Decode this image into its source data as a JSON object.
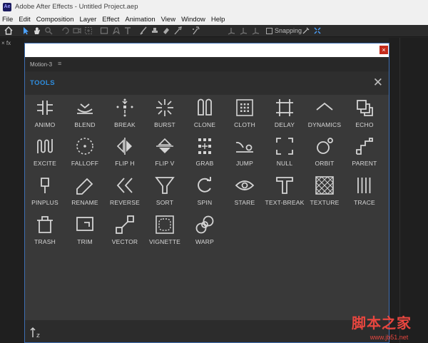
{
  "window": {
    "app_logo_text": "Ae",
    "title": "Adobe After Effects - Untitled Project.aep"
  },
  "menu": [
    "File",
    "Edit",
    "Composition",
    "Layer",
    "Effect",
    "Animation",
    "View",
    "Window",
    "Help"
  ],
  "toolbar": {
    "snapping_label": "Snapping"
  },
  "panel": {
    "tab_label": "Motion-3",
    "tab_menu_glyph": "≡",
    "section_title": "TOOLS",
    "close_glyph": "✕",
    "window_close_glyph": "×",
    "tools": [
      {
        "label": "ANIMO",
        "icon": "animo-icon"
      },
      {
        "label": "BLEND",
        "icon": "blend-icon"
      },
      {
        "label": "BREAK",
        "icon": "break-icon"
      },
      {
        "label": "BURST",
        "icon": "burst-icon"
      },
      {
        "label": "CLONE",
        "icon": "clone-icon"
      },
      {
        "label": "CLOTH",
        "icon": "cloth-icon"
      },
      {
        "label": "DELAY",
        "icon": "delay-icon"
      },
      {
        "label": "DYNAMICS",
        "icon": "dynamics-icon"
      },
      {
        "label": "ECHO",
        "icon": "echo-icon"
      },
      {
        "label": "EXCITE",
        "icon": "excite-icon"
      },
      {
        "label": "FALLOFF",
        "icon": "falloff-icon"
      },
      {
        "label": "FLIP H",
        "icon": "flip-h-icon"
      },
      {
        "label": "FLIP V",
        "icon": "flip-v-icon"
      },
      {
        "label": "GRAB",
        "icon": "grab-icon"
      },
      {
        "label": "JUMP",
        "icon": "jump-icon"
      },
      {
        "label": "NULL",
        "icon": "null-icon"
      },
      {
        "label": "ORBIT",
        "icon": "orbit-icon"
      },
      {
        "label": "PARENT",
        "icon": "parent-icon"
      },
      {
        "label": "PINPLUS",
        "icon": "pinplus-icon"
      },
      {
        "label": "RENAME",
        "icon": "rename-icon"
      },
      {
        "label": "REVERSE",
        "icon": "reverse-icon"
      },
      {
        "label": "SORT",
        "icon": "sort-icon"
      },
      {
        "label": "SPIN",
        "icon": "spin-icon"
      },
      {
        "label": "STARE",
        "icon": "stare-icon"
      },
      {
        "label": "TEXT-BREAK",
        "icon": "text-break-icon"
      },
      {
        "label": "TEXTURE",
        "icon": "texture-icon"
      },
      {
        "label": "TRACE",
        "icon": "trace-icon"
      },
      {
        "label": "TRASH",
        "icon": "trash-icon"
      },
      {
        "label": "TRIM",
        "icon": "trim-icon"
      },
      {
        "label": "VECTOR",
        "icon": "vector-icon"
      },
      {
        "label": "VIGNETTE",
        "icon": "vignette-icon"
      },
      {
        "label": "WARP",
        "icon": "warp-icon"
      }
    ]
  },
  "watermark": {
    "text": "脚本之家",
    "url": "www.jb51.net"
  },
  "colors": {
    "accent": "#2e8ee0",
    "panel_bg": "#393939",
    "close_red": "#c42b1c"
  }
}
